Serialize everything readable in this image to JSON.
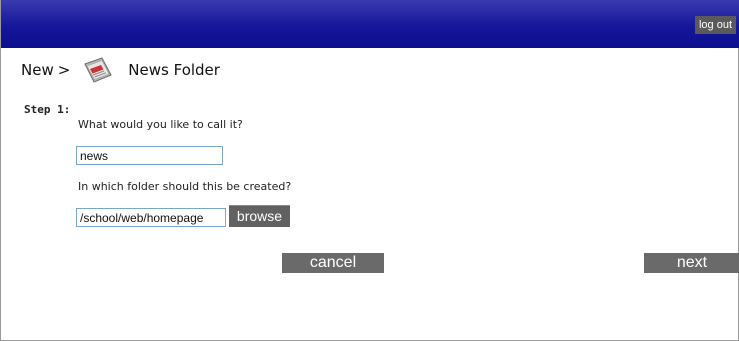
{
  "header": {
    "logout_label": "log out"
  },
  "breadcrumb": {
    "new_label": "New",
    "separator": ">",
    "icon": "news-folder-icon",
    "title": "News Folder"
  },
  "step": {
    "label": "Step 1:",
    "question_name": "What would you like to call it?",
    "name_value": "news",
    "question_folder": "In which folder should this be created?",
    "folder_value": "/school/web/homepage",
    "browse_label": "browse"
  },
  "actions": {
    "cancel_label": "cancel",
    "next_label": "next"
  },
  "colors": {
    "header_blue": "#16169a",
    "button_gray": "#6a6a6a",
    "field_border": "#7aa6c9"
  }
}
